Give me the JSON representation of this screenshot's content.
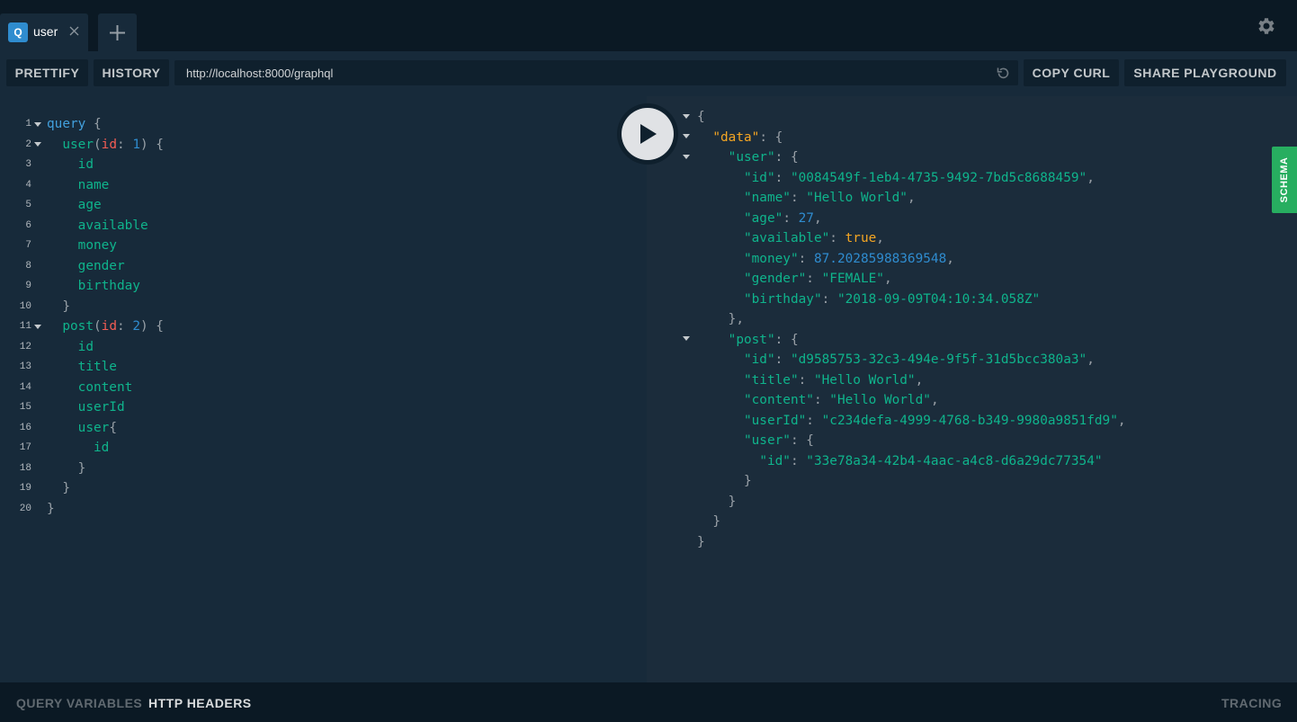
{
  "tabs": [
    {
      "badge": "Q",
      "title": "user"
    }
  ],
  "toolbar": {
    "prettify_label": "PRETTIFY",
    "history_label": "HISTORY",
    "endpoint_url": "http://localhost:8000/graphql",
    "copy_curl_label": "COPY CURL",
    "share_label": "SHARE PLAYGROUND"
  },
  "sidebar": {
    "schema_label": "SCHEMA"
  },
  "bottom": {
    "query_variables_label": "QUERY VARIABLES",
    "http_headers_label": "HTTP HEADERS",
    "tracing_label": "TRACING"
  },
  "editor": {
    "line_numbers": [
      "1",
      "2",
      "3",
      "4",
      "5",
      "6",
      "7",
      "8",
      "9",
      "10",
      "11",
      "12",
      "13",
      "14",
      "15",
      "16",
      "17",
      "18",
      "19",
      "20"
    ],
    "query": {
      "keyword": "query",
      "user_field": "user",
      "user_arg": "id",
      "user_arg_value": "1",
      "user_fields": [
        "id",
        "name",
        "age",
        "available",
        "money",
        "gender",
        "birthday"
      ],
      "post_field": "post",
      "post_arg": "id",
      "post_arg_value": "2",
      "post_fields": [
        "id",
        "title",
        "content",
        "userId"
      ],
      "post_user_field": "user",
      "post_user_subfield": "id"
    }
  },
  "result": {
    "data_key": "\"data\"",
    "user_key": "\"user\"",
    "user": [
      {
        "key": "\"id\"",
        "value": "\"0084549f-1eb4-4735-9492-7bd5c8688459\"",
        "type": "string"
      },
      {
        "key": "\"name\"",
        "value": "\"Hello World\"",
        "type": "string"
      },
      {
        "key": "\"age\"",
        "value": "27",
        "type": "number"
      },
      {
        "key": "\"available\"",
        "value": "true",
        "type": "bool"
      },
      {
        "key": "\"money\"",
        "value": "87.20285988369548",
        "type": "number"
      },
      {
        "key": "\"gender\"",
        "value": "\"FEMALE\"",
        "type": "string"
      },
      {
        "key": "\"birthday\"",
        "value": "\"2018-09-09T04:10:34.058Z\"",
        "type": "string"
      }
    ],
    "post_key": "\"post\"",
    "post": [
      {
        "key": "\"id\"",
        "value": "\"d9585753-32c3-494e-9f5f-31d5bcc380a3\"",
        "type": "string"
      },
      {
        "key": "\"title\"",
        "value": "\"Hello World\"",
        "type": "string"
      },
      {
        "key": "\"content\"",
        "value": "\"Hello World\"",
        "type": "string"
      },
      {
        "key": "\"userId\"",
        "value": "\"c234defa-4999-4768-b349-9980a9851fd9\"",
        "type": "string"
      }
    ],
    "post_user_key": "\"user\"",
    "post_user_id_key": "\"id\"",
    "post_user_id_value": "\"33e78a34-42b4-4aac-a4c8-d6a29dc77354\""
  },
  "colors": {
    "accent": "#2f8ccf",
    "schema_green": "#27ae60",
    "string": "#0fb48c",
    "keyword": "#42a0dd",
    "argument": "#f25c54",
    "data_key": "#f5a623"
  },
  "icons": [
    "close-icon",
    "plus-icon",
    "gear-icon",
    "reload-icon",
    "play-icon",
    "fold-arrow-icon"
  ]
}
